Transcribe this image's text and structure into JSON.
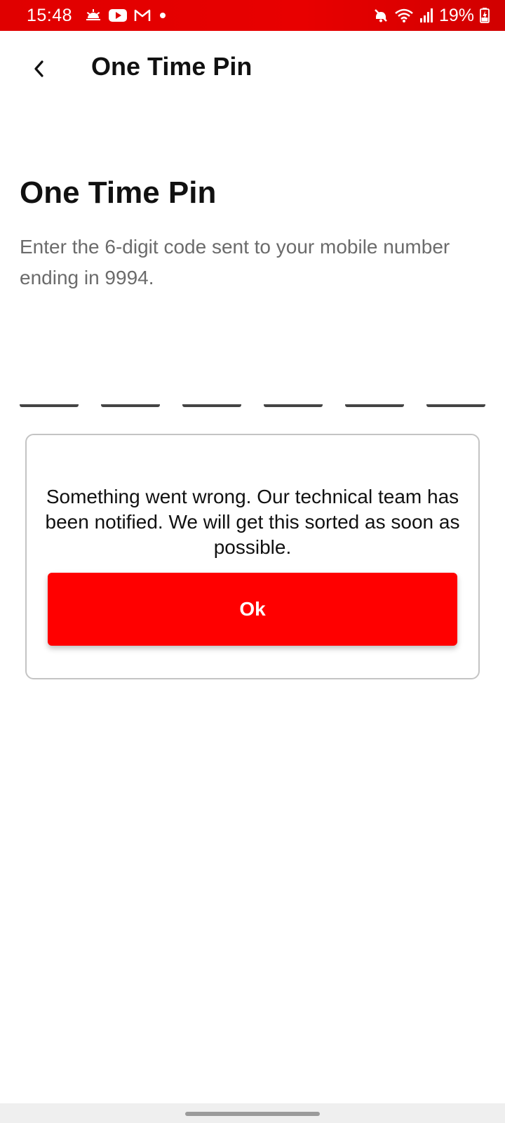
{
  "status_bar": {
    "time": "15:48",
    "battery": "19%",
    "left_icons": [
      "weather-icon",
      "youtube-icon",
      "gmail-icon",
      "notification-dot-icon"
    ],
    "right_icons": [
      "mute-icon",
      "wifi-icon",
      "signal-icon",
      "battery-charging-icon"
    ],
    "background_color": "#e00000"
  },
  "app_bar": {
    "title": "One Time Pin",
    "back_icon": "chevron-left-icon"
  },
  "main": {
    "heading": "One Time Pin",
    "description": "Enter the 6-digit code sent to your mobile number ending in 9994.",
    "otp_digits": [
      "",
      "",
      "",
      "",
      "",
      ""
    ]
  },
  "error_dialog": {
    "message": "Something went wrong. Our technical team has been notified. We will get this sorted as soon as possible.",
    "ok_label": "Ok",
    "button_color": "#ff0000"
  }
}
